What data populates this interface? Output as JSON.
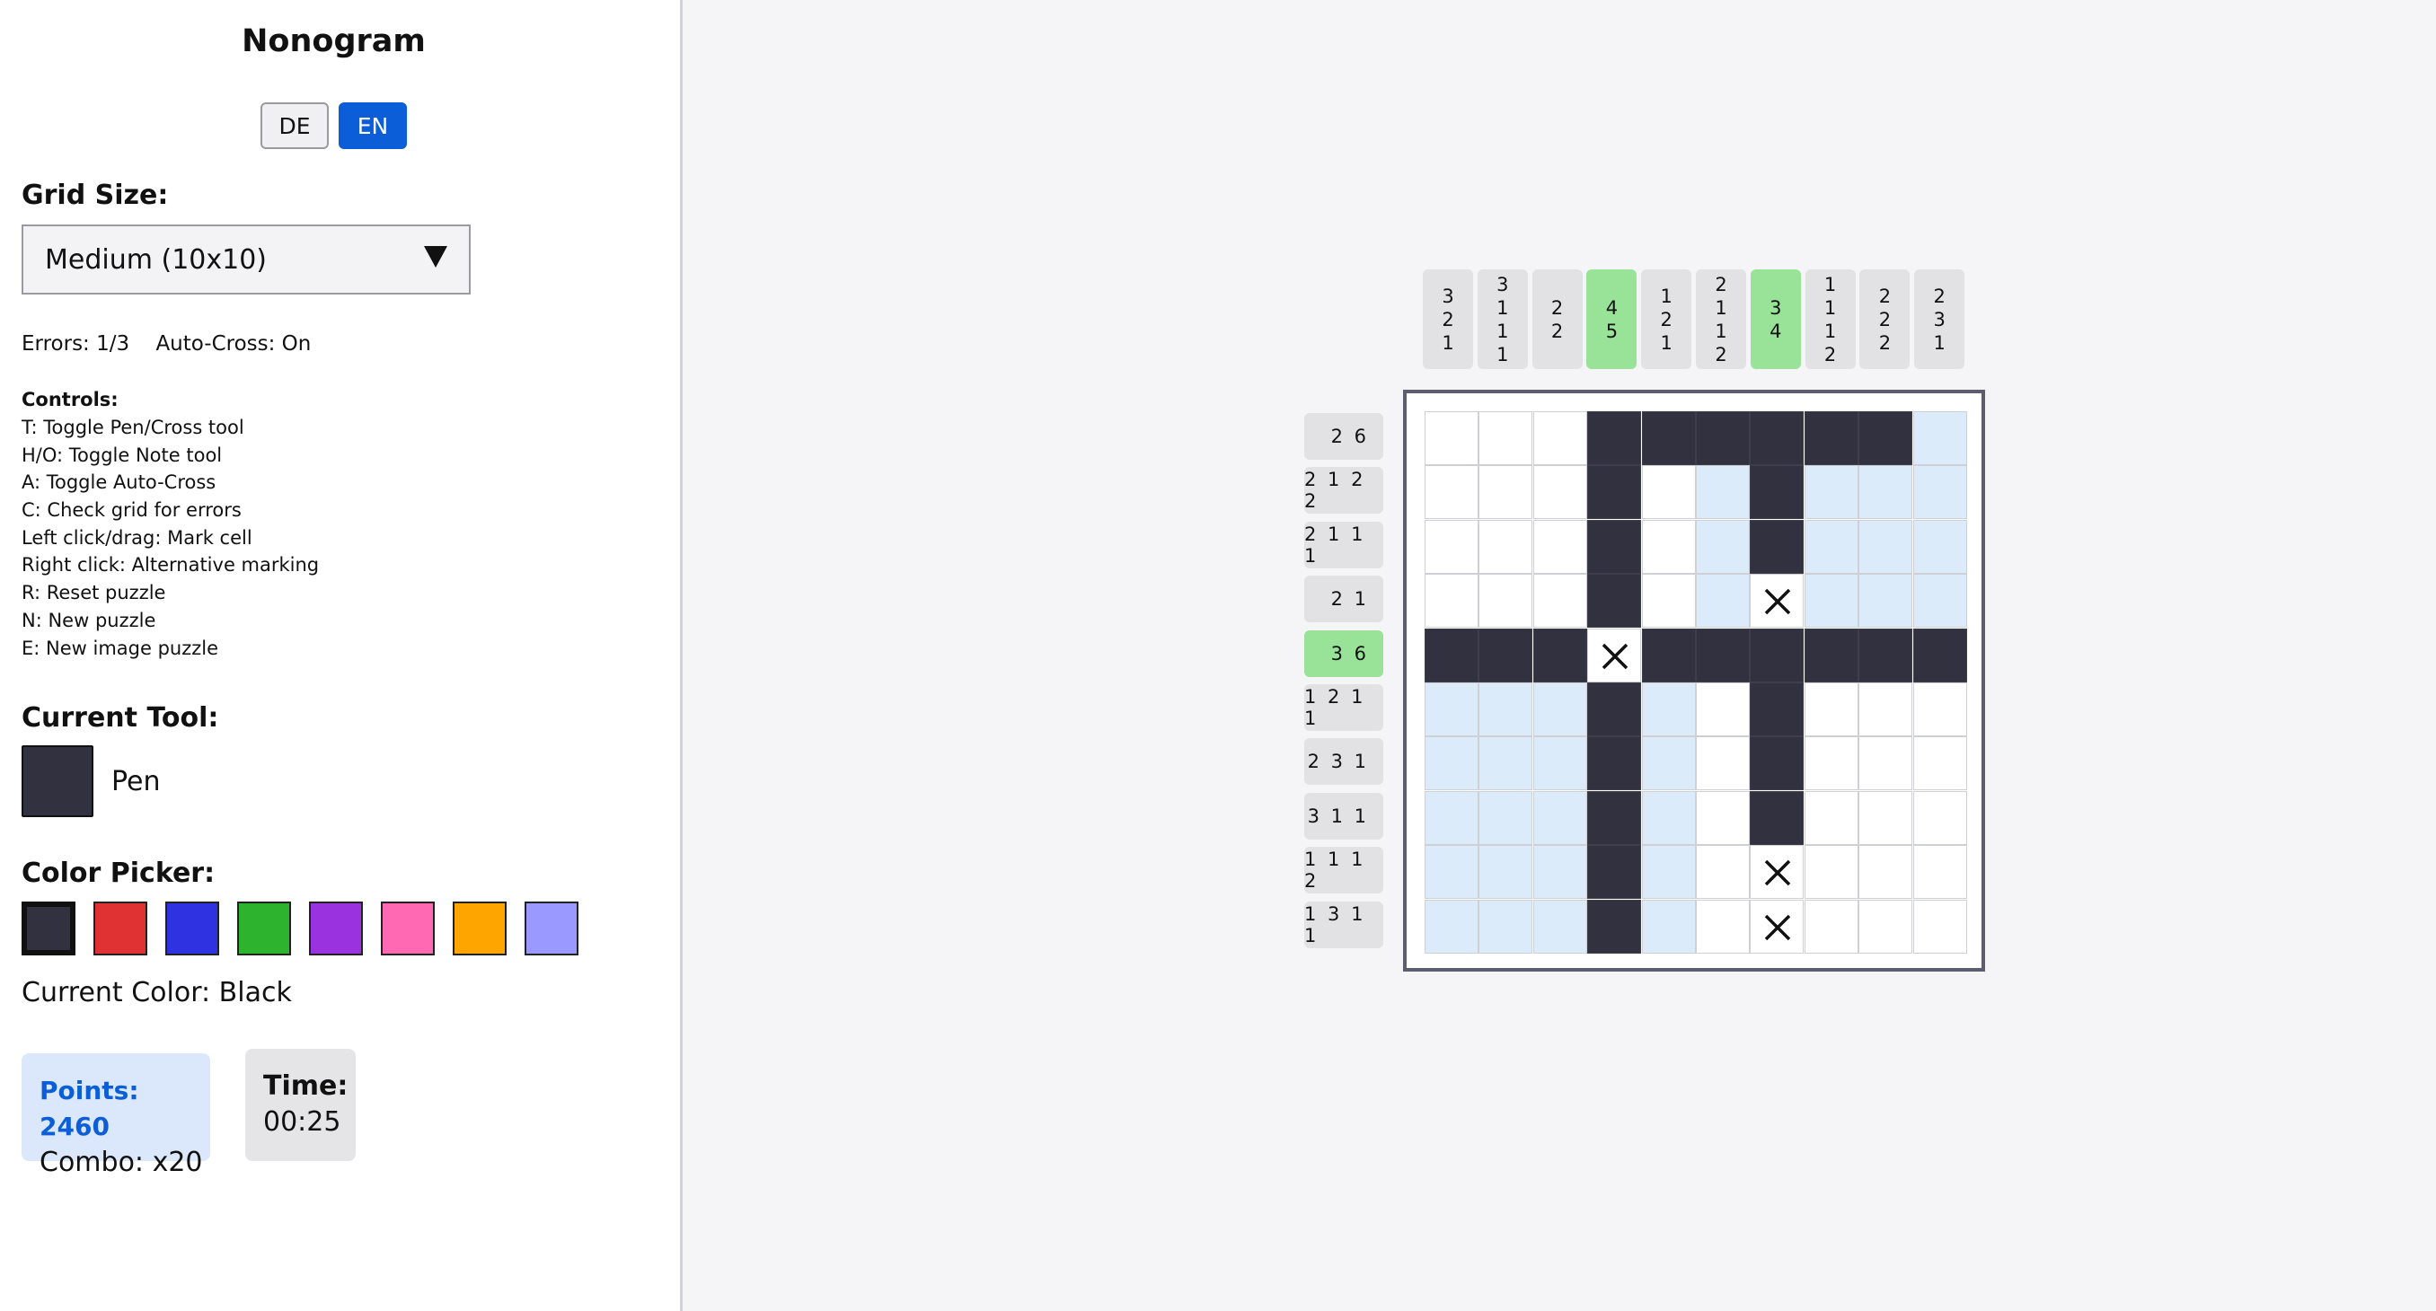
{
  "app": {
    "title": "Nonogram"
  },
  "language": {
    "options": [
      "DE",
      "EN"
    ],
    "selected": "EN"
  },
  "grid_size": {
    "label": "Grid Size:",
    "value": "Medium (10x10)"
  },
  "status": {
    "errors": "Errors: 1/3",
    "auto_cross": "Auto-Cross: On"
  },
  "controls": {
    "title": "Controls:",
    "items": [
      "T: Toggle Pen/Cross tool",
      "H/O: Toggle Note tool",
      "A: Toggle Auto-Cross",
      "C: Check grid for errors",
      "Left click/drag: Mark cell",
      "Right click: Alternative marking",
      "R: Reset puzzle",
      "N: New puzzle",
      "E: New image puzzle"
    ]
  },
  "tool": {
    "label": "Current Tool:",
    "name": "Pen",
    "color": "#31313f"
  },
  "color_picker": {
    "label": "Color Picker:",
    "colors": [
      {
        "name": "Black",
        "hex": "#31313f"
      },
      {
        "name": "Red",
        "hex": "#e03232"
      },
      {
        "name": "Blue",
        "hex": "#2f32e0"
      },
      {
        "name": "Green",
        "hex": "#2db32d"
      },
      {
        "name": "Purple",
        "hex": "#9b32e0"
      },
      {
        "name": "Pink",
        "hex": "#ff69b4"
      },
      {
        "name": "Orange",
        "hex": "#ffa500"
      },
      {
        "name": "Lavender",
        "hex": "#9999ff"
      }
    ],
    "selected_index": 0,
    "current_color_text": "Current Color: Black"
  },
  "score": {
    "points": "Points: 2460",
    "combo": "Combo: x20"
  },
  "timer": {
    "label": "Time:",
    "value": "00:25"
  },
  "puzzle": {
    "column_clues": [
      {
        "nums": [
          "3",
          "2",
          "1"
        ],
        "done": false
      },
      {
        "nums": [
          "3",
          "1",
          "1",
          "1"
        ],
        "done": false
      },
      {
        "nums": [
          "2",
          "2"
        ],
        "done": false
      },
      {
        "nums": [
          "4",
          "5"
        ],
        "done": true
      },
      {
        "nums": [
          "1",
          "2",
          "1"
        ],
        "done": false
      },
      {
        "nums": [
          "2",
          "1",
          "1",
          "2"
        ],
        "done": false
      },
      {
        "nums": [
          "3",
          "4"
        ],
        "done": true
      },
      {
        "nums": [
          "1",
          "1",
          "1",
          "2"
        ],
        "done": false
      },
      {
        "nums": [
          "2",
          "2",
          "2"
        ],
        "done": false
      },
      {
        "nums": [
          "2",
          "3",
          "1"
        ],
        "done": false
      }
    ],
    "row_clues": [
      {
        "text": "2 6",
        "done": false
      },
      {
        "text": "2 1 2 2",
        "done": false
      },
      {
        "text": "2 1 1 1",
        "done": false
      },
      {
        "text": "2 1",
        "done": false
      },
      {
        "text": "3 6",
        "done": true
      },
      {
        "text": "1 2 1 1",
        "done": false
      },
      {
        "text": "2 3 1",
        "done": false
      },
      {
        "text": "3 1 1",
        "done": false
      },
      {
        "text": "1 1 1 2",
        "done": false
      },
      {
        "text": "1 3 1 1",
        "done": false
      }
    ],
    "cell_legend": {
      "F": "filled",
      "X": "crossed",
      "h": "highlighted",
      ".": "empty"
    },
    "grid": [
      "...FFFFFFh",
      "...F.hFhhh",
      "...F.hFhhh",
      "...F.hXhhh",
      "FFFXFFFFFF",
      "hhhFh.F...",
      "hhhFh.F...",
      "hhhFh.F...",
      "hhhFh.X...",
      "hhhFh.X..."
    ]
  }
}
